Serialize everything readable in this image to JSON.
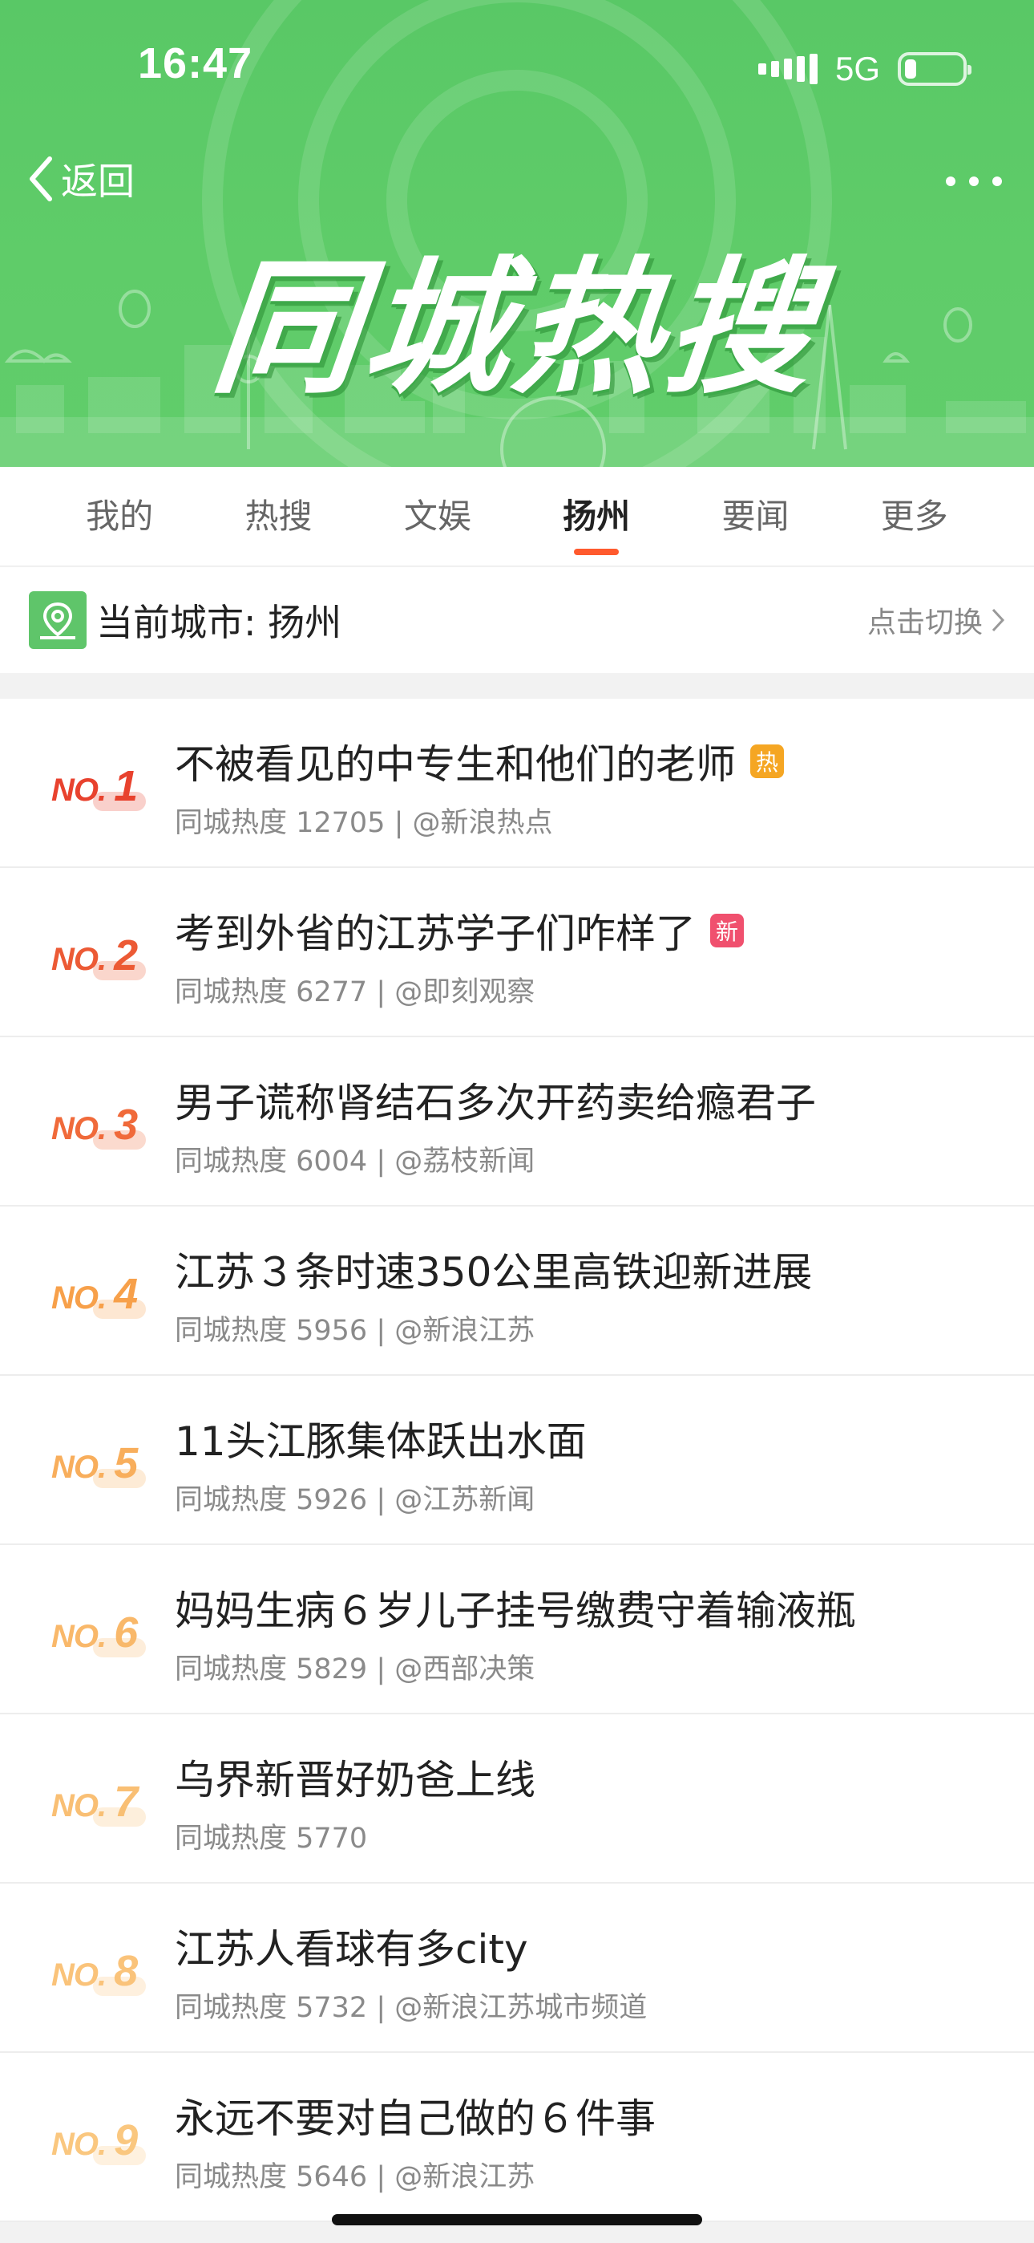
{
  "status_bar": {
    "time": "16:47",
    "network": "5G",
    "battery_level": 0.2
  },
  "header": {
    "back_label": "返回",
    "banner_title": "同城热搜"
  },
  "tabs": [
    {
      "label": "我的",
      "active": false
    },
    {
      "label": "热搜",
      "active": false
    },
    {
      "label": "文娱",
      "active": false
    },
    {
      "label": "扬州",
      "active": true
    },
    {
      "label": "要闻",
      "active": false
    },
    {
      "label": "更多",
      "active": false
    }
  ],
  "city_bar": {
    "label": "当前城市: 扬州",
    "switch_label": "点击切换"
  },
  "colors": {
    "header_green": "#5fcc69",
    "accent": "#ff5a2e",
    "hot_badge": "#f5a623",
    "new_badge": "#f0506e"
  },
  "items": [
    {
      "rank_prefix": "NO.",
      "rank": "1",
      "title": "不被看见的中专生和他们的老师",
      "badge": "热",
      "meta": "同城热度 12705 | @新浪热点"
    },
    {
      "rank_prefix": "NO.",
      "rank": "2",
      "title": "考到外省的江苏学子们咋样了",
      "badge": "新",
      "meta": "同城热度 6277 | @即刻观察"
    },
    {
      "rank_prefix": "NO.",
      "rank": "3",
      "title": "男子谎称肾结石多次开药卖给瘾君子",
      "badge": "",
      "meta": "同城热度 6004 | @荔枝新闻"
    },
    {
      "rank_prefix": "NO.",
      "rank": "4",
      "title": "江苏３条时速350公里高铁迎新进展",
      "badge": "",
      "meta": "同城热度 5956 | @新浪江苏"
    },
    {
      "rank_prefix": "NO.",
      "rank": "5",
      "title": "11头江豚集体跃出水面",
      "badge": "",
      "meta": "同城热度 5926 | @江苏新闻"
    },
    {
      "rank_prefix": "NO.",
      "rank": "6",
      "title": "妈妈生病６岁儿子挂号缴费守着输液瓶",
      "badge": "",
      "meta": "同城热度 5829 | @西部决策"
    },
    {
      "rank_prefix": "NO.",
      "rank": "7",
      "title": "乌界新晋好奶爸上线",
      "badge": "",
      "meta": "同城热度 5770"
    },
    {
      "rank_prefix": "NO.",
      "rank": "8",
      "title": "江苏人看球有多city",
      "badge": "",
      "meta": "同城热度 5732 | @新浪江苏城市频道"
    },
    {
      "rank_prefix": "NO.",
      "rank": "9",
      "title": "永远不要对自己做的６件事",
      "badge": "",
      "meta": "同城热度 5646 | @新浪江苏"
    }
  ]
}
